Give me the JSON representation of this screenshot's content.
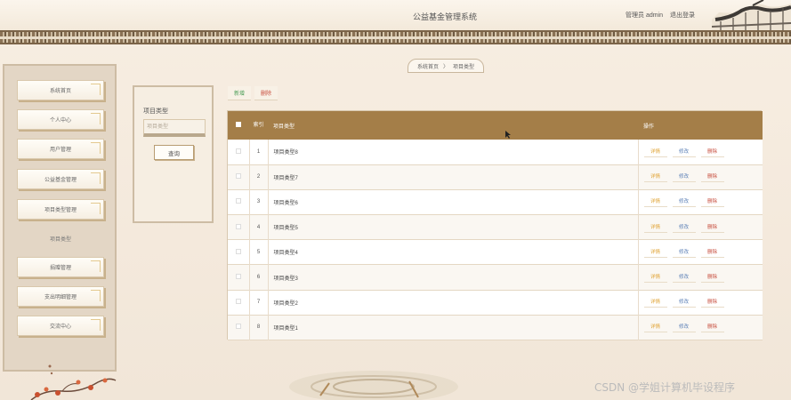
{
  "header": {
    "title": "公益基金管理系统",
    "admin_label": "管理员 admin",
    "logout": "退出登录"
  },
  "breadcrumb": {
    "home": "系统首页",
    "separator": "〉",
    "current": "项目类型"
  },
  "sidebar": {
    "items": [
      {
        "label": "系统首页"
      },
      {
        "label": "个人中心"
      },
      {
        "label": "用户管理"
      },
      {
        "label": "公益基金管理"
      },
      {
        "label": "项目类型管理"
      }
    ],
    "section_label": "项目类型",
    "items2": [
      {
        "label": "捐赠管理"
      },
      {
        "label": "支出明细管理"
      },
      {
        "label": "交流中心"
      }
    ]
  },
  "search": {
    "label": "项目类型",
    "placeholder": "项目类型",
    "button": "查询"
  },
  "actions": {
    "add": "新增",
    "delete": "删除"
  },
  "table": {
    "headers": {
      "index": "索引",
      "type": "项目类型",
      "ops": "操作"
    },
    "row_ops": {
      "detail": "详情",
      "edit": "修改",
      "delete": "删除"
    },
    "rows": [
      {
        "index": "1",
        "type": "项目类型8"
      },
      {
        "index": "2",
        "type": "项目类型7"
      },
      {
        "index": "3",
        "type": "项目类型6"
      },
      {
        "index": "4",
        "type": "项目类型5"
      },
      {
        "index": "5",
        "type": "项目类型4"
      },
      {
        "index": "6",
        "type": "项目类型3"
      },
      {
        "index": "7",
        "type": "项目类型2"
      },
      {
        "index": "8",
        "type": "项目类型1"
      }
    ]
  },
  "watermark": "CSDN @学姐计算机毕设程序",
  "colors": {
    "header_bg": "#a47e48",
    "detail": "#e0a334",
    "edit": "#5a7fb6",
    "delete": "#c74d3d",
    "add": "#4a9d56"
  }
}
